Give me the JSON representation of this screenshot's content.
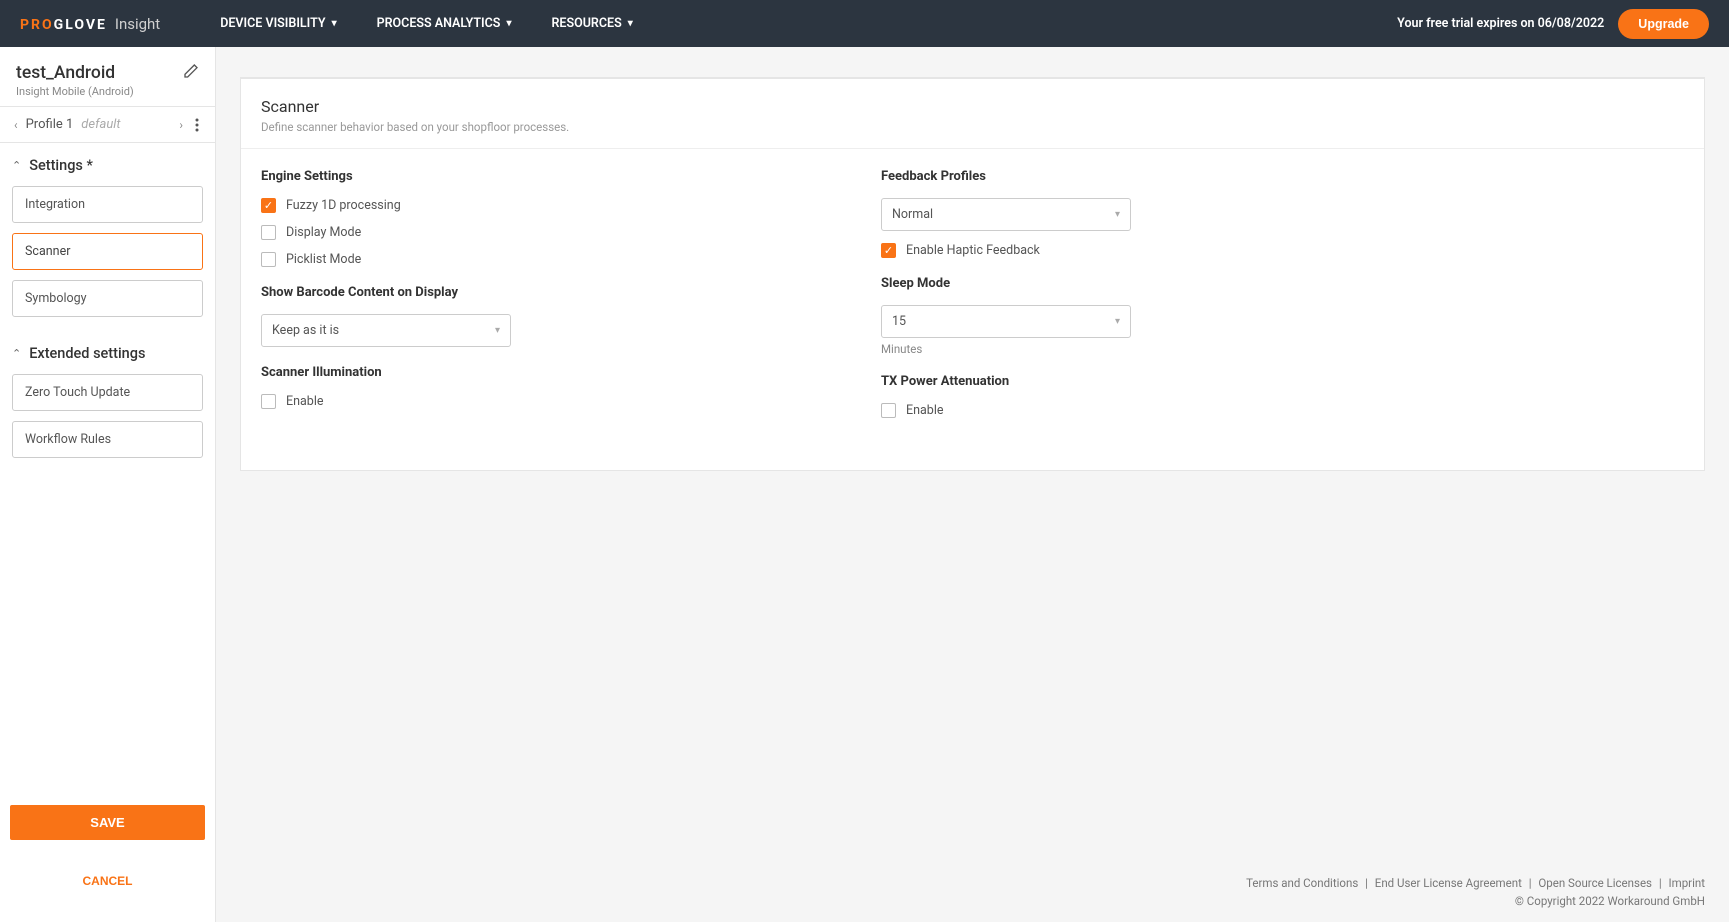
{
  "brand": {
    "pro": "PRO",
    "glove": "GLOVE",
    "product": "Insight"
  },
  "nav": {
    "device_visibility": "DEVICE VISIBILITY",
    "process_analytics": "PROCESS ANALYTICS",
    "resources": "RESOURCES"
  },
  "trial": {
    "text": "Your free trial expires on 06/08/2022",
    "upgrade": "Upgrade"
  },
  "sidebar": {
    "title": "test_Android",
    "subtitle": "Insight Mobile (Android)",
    "profile": {
      "name": "Profile 1",
      "tag": "default"
    },
    "settings_heading": "Settings *",
    "items": {
      "integration": "Integration",
      "scanner": "Scanner",
      "symbology": "Symbology"
    },
    "extended_heading": "Extended settings",
    "extended": {
      "zero_touch": "Zero Touch Update",
      "workflow": "Workflow Rules"
    },
    "save": "SAVE",
    "cancel": "CANCEL"
  },
  "scanner": {
    "title": "Scanner",
    "desc": "Define scanner behavior based on your shopfloor processes.",
    "engine_heading": "Engine Settings",
    "fuzzy": "Fuzzy 1D processing",
    "display_mode": "Display Mode",
    "picklist": "Picklist Mode",
    "show_barcode_heading": "Show Barcode Content on Display",
    "show_barcode_value": "Keep as it is",
    "illumination_heading": "Scanner Illumination",
    "illumination_enable": "Enable",
    "feedback_heading": "Feedback Profiles",
    "feedback_value": "Normal",
    "haptic": "Enable Haptic Feedback",
    "sleep_heading": "Sleep Mode",
    "sleep_value": "15",
    "sleep_hint": "Minutes",
    "tx_heading": "TX Power Attenuation",
    "tx_enable": "Enable"
  },
  "footer": {
    "terms": "Terms and Conditions",
    "eula": "End User License Agreement",
    "oss": "Open Source Licenses",
    "imprint": "Imprint",
    "copyright": "© Copyright 2022 Workaround GmbH"
  }
}
